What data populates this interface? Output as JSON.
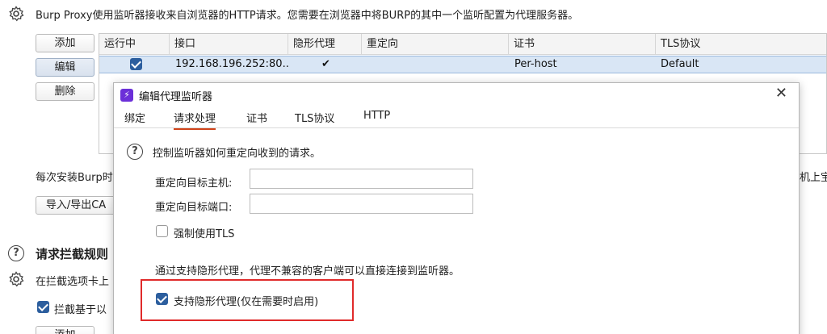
{
  "header": {
    "description": "Burp Proxy使用监听器接收来自浏览器的HTTP请求。您需要在浏览器中将BURP的其中一个监听配置为代理服务器。"
  },
  "side_buttons": {
    "add": "添加",
    "edit": "编辑",
    "remove": "删除"
  },
  "table": {
    "columns": [
      "运行中",
      "接口",
      "隐形代理",
      "重定向",
      "证书",
      "TLS协议"
    ],
    "rows": [
      {
        "running": true,
        "interface": "192.168.196.252:80...",
        "invisible": "✔",
        "redirect": "",
        "certificate": "Per-host",
        "tls": "Default"
      }
    ]
  },
  "background": {
    "cert_text_left": "每次安装Burp时",
    "cert_text_right": "机上宝",
    "import_export_label": "导入/导出CA",
    "intercept_title": "请求拦截规则",
    "intercept_desc": "在拦截选项卡上",
    "intercept_check_label": "拦截基于以",
    "bottom_add": "添加"
  },
  "dialog": {
    "title": "编辑代理监听器",
    "close": "✕",
    "tabs": [
      "绑定",
      "请求处理",
      "证书",
      "TLS协议",
      "HTTP"
    ],
    "active_tab": "请求处理",
    "intro": "控制监听器如何重定向收到的请求。",
    "redirect_host_label": "重定向目标主机:",
    "redirect_host_value": "",
    "redirect_port_label": "重定向目标端口:",
    "redirect_port_value": "",
    "force_tls_label": "强制使用TLS",
    "force_tls_checked": false,
    "invisible_desc": "通过支持隐形代理，代理不兼容的客户端可以直接连接到监听器。",
    "invisible_label": "支持隐形代理(仅在需要时启用)",
    "invisible_checked": true
  },
  "colors": {
    "accent": "#2c5e9e",
    "tab_underline": "#d0441b",
    "highlight_box": "#e02a2a",
    "selected_row": "#d9e6f5"
  }
}
